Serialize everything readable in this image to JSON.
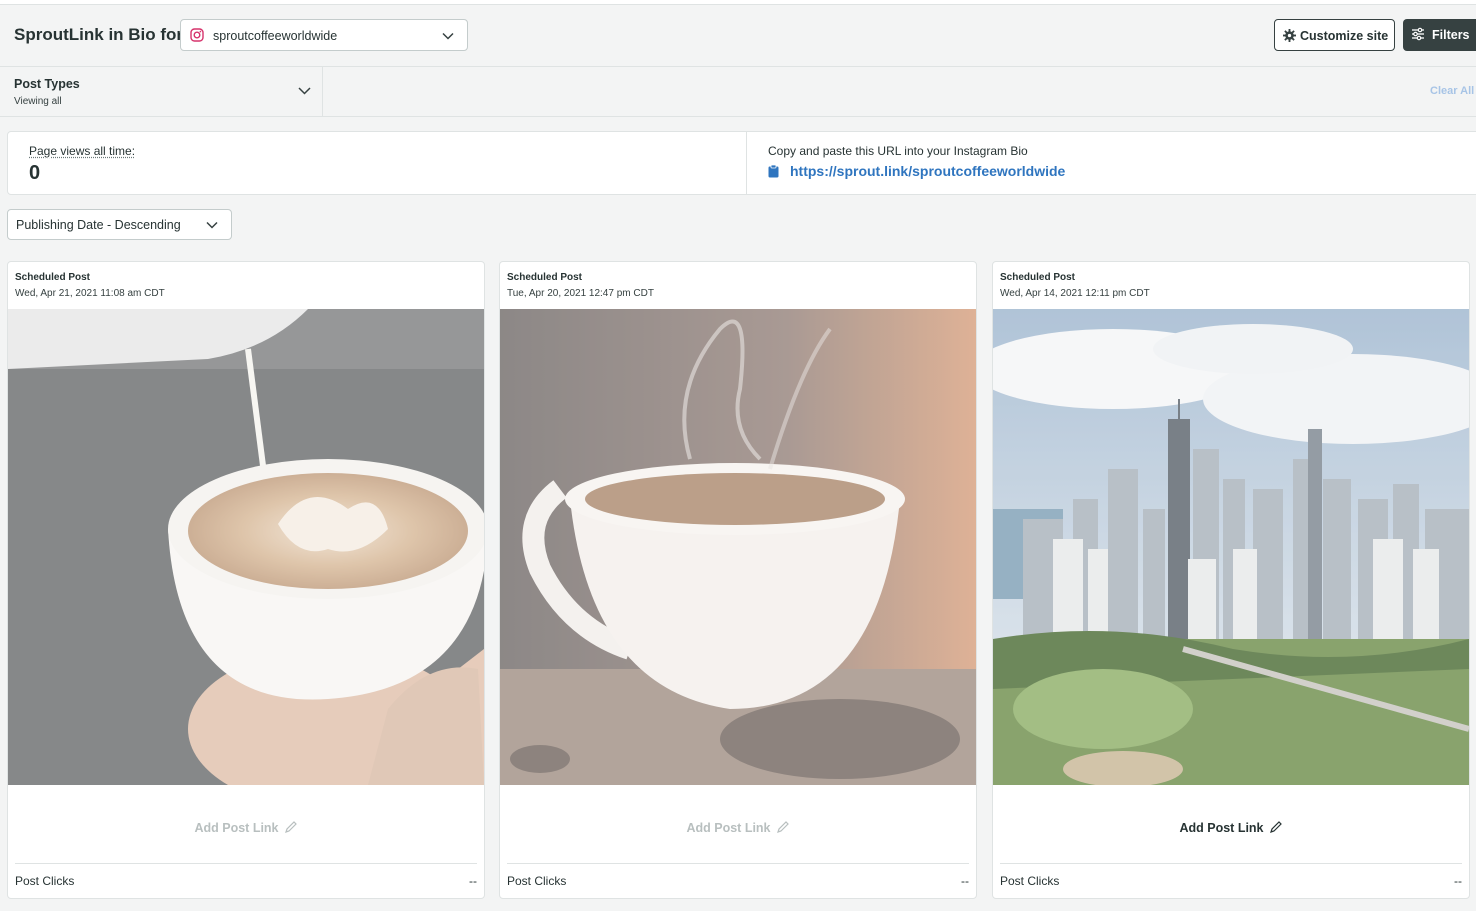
{
  "header": {
    "title": "SproutLink in Bio for",
    "profile": {
      "name": "sproutcoffeeworldwide",
      "icon": "instagram-icon"
    },
    "customize_label": "Customize site",
    "filters_label": "Filters"
  },
  "filterbar": {
    "post_types_title": "Post Types",
    "post_types_sub": "Viewing all",
    "clear_all": "Clear All"
  },
  "stats": {
    "page_views_label": "Page views all time:",
    "page_views_value": "0",
    "url_label": "Copy and paste this URL into your Instagram Bio",
    "url": "https://sprout.link/sproutcoffeeworldwide"
  },
  "sort": {
    "selected": "Publishing Date - Descending"
  },
  "posts": [
    {
      "type": "Scheduled Post",
      "date": "Wed, Apr 21, 2021 11:08 am CDT",
      "image": "latte-art-photo",
      "add_link": "Add Post Link",
      "clicks_label": "Post Clicks",
      "clicks_value": "--"
    },
    {
      "type": "Scheduled Post",
      "date": "Tue, Apr 20, 2021 12:47 pm CDT",
      "image": "steaming-coffee-cup-photo",
      "add_link": "Add Post Link",
      "clicks_label": "Post Clicks",
      "clicks_value": "--"
    },
    {
      "type": "Scheduled Post",
      "date": "Wed, Apr 14, 2021 12:11 pm CDT",
      "image": "chicago-skyline-photo",
      "add_link": "Add Post Link",
      "clicks_label": "Post Clicks",
      "clicks_value": "--"
    }
  ],
  "colors": {
    "accent_link": "#2f75bf",
    "dark_button": "#364141",
    "background": "#f3f4f4"
  }
}
